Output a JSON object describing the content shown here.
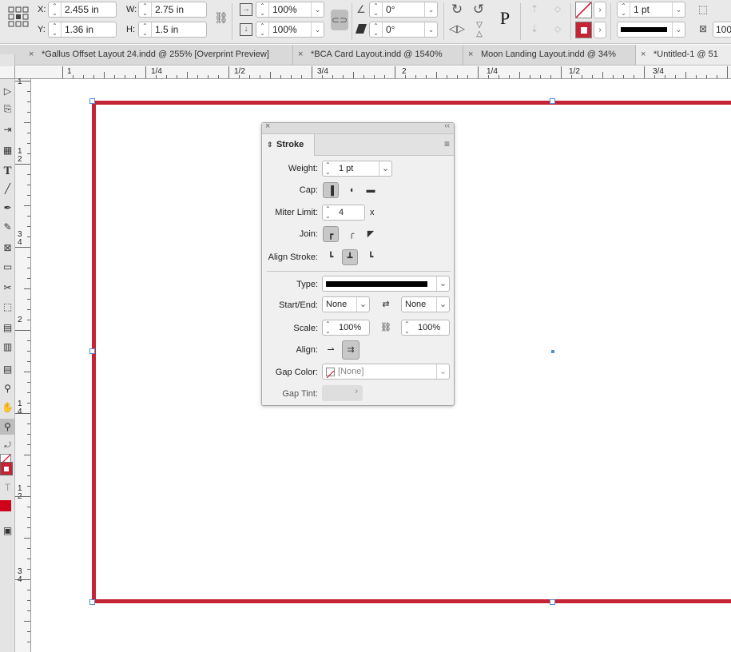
{
  "control_bar": {
    "x_label": "X:",
    "x_value": "2.455 in",
    "y_label": "Y:",
    "y_value": "1.36 in",
    "w_label": "W:",
    "w_value": "2.75 in",
    "h_label": "H:",
    "h_value": "1.5 in",
    "scale_x_value": "100%",
    "scale_y_value": "100%",
    "rotate_value": "0°",
    "shear_value": "0°",
    "stroke_weight_value": "1 pt",
    "scale_x_partial": "100",
    "p_glyph": "P"
  },
  "tabs": [
    {
      "label": "*Gallus Offset Layout 24.indd @ 255% [Overprint Preview]"
    },
    {
      "label": "*BCA Card Layout.indd @ 1540%"
    },
    {
      "label": "Moon Landing Layout.indd @ 34%"
    },
    {
      "label": "*Untitled-1 @ 51"
    }
  ],
  "hruler": {
    "labels": [
      "1",
      "1/4",
      "1/2",
      "3/4",
      "2",
      "1/4",
      "1/2",
      "3/4"
    ]
  },
  "vruler": {
    "labels": [
      "1",
      "2",
      "3",
      "4",
      "2",
      "1",
      "4",
      "1",
      "2",
      "3",
      "4",
      "1",
      "2",
      "3",
      "4"
    ]
  },
  "stroke_panel": {
    "title": "Stroke",
    "weight_label": "Weight:",
    "weight_value": "1 pt",
    "cap_label": "Cap:",
    "miter_label": "Miter Limit:",
    "miter_value": "4",
    "miter_unit": "x",
    "join_label": "Join:",
    "align_stroke_label": "Align Stroke:",
    "type_label": "Type:",
    "start_end_label": "Start/End:",
    "start_value": "None",
    "end_value": "None",
    "scale_label": "Scale:",
    "scale_start_value": "100%",
    "scale_end_value": "100%",
    "align_label": "Align:",
    "gap_color_label": "Gap Color:",
    "gap_color_value": "[None]",
    "gap_tint_label": "Gap Tint:"
  },
  "colors": {
    "frame_stroke": "#c42434",
    "selection": "#4a90d9"
  }
}
